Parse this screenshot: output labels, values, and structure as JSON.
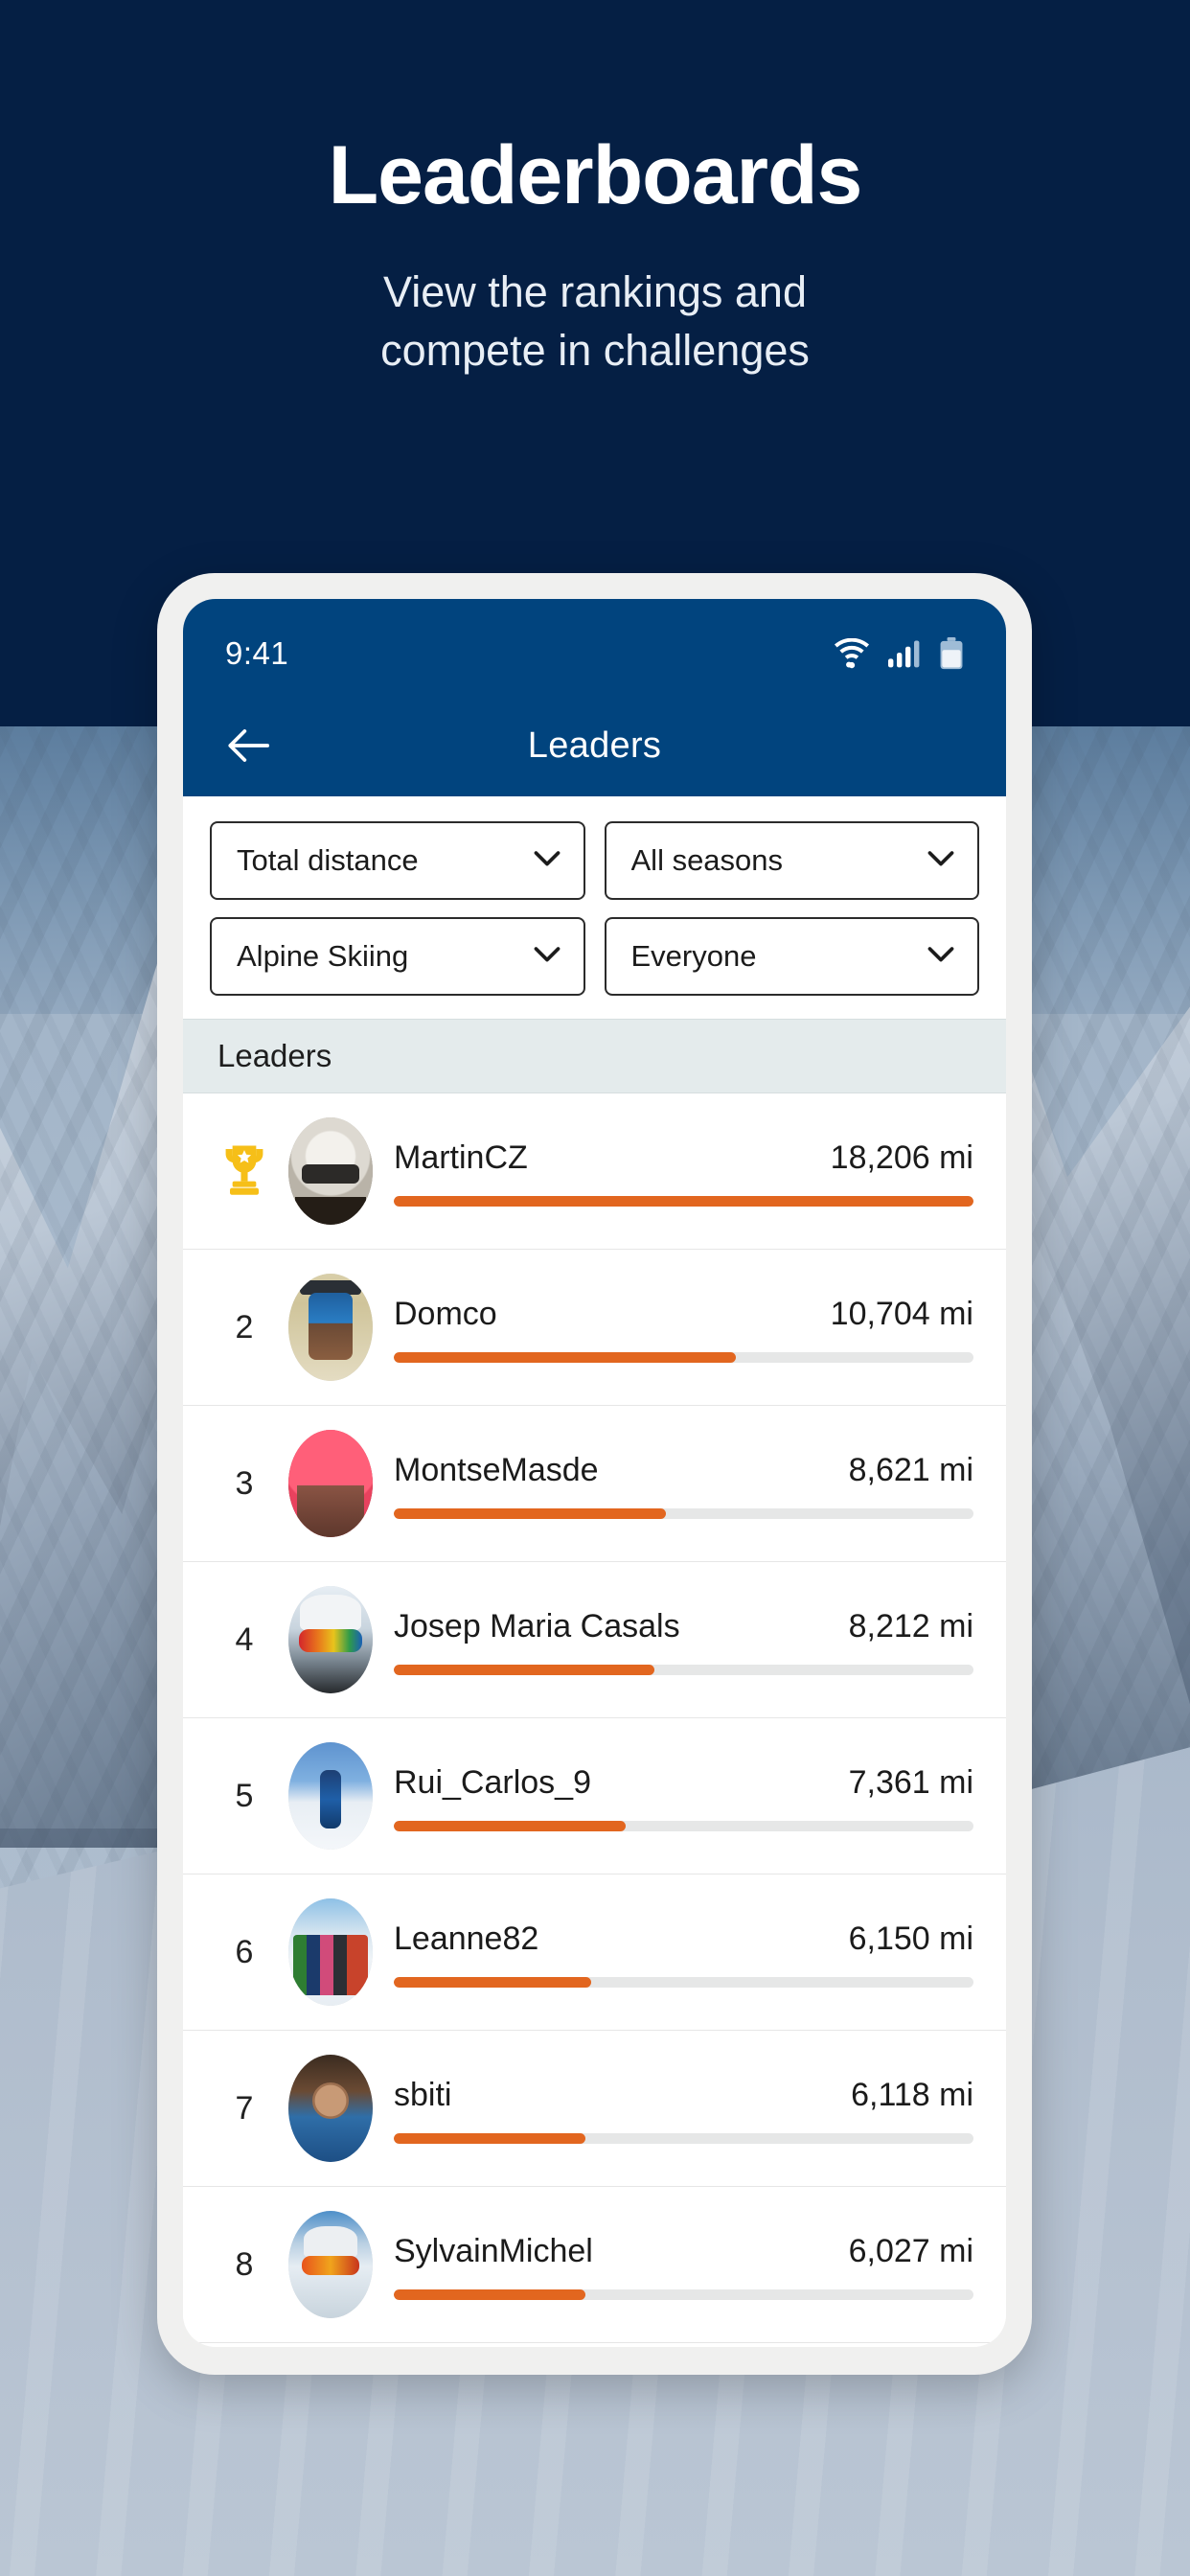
{
  "hero": {
    "title": "Leaderboards",
    "subtitle_line1": "View the rankings and",
    "subtitle_line2": "compete in challenges",
    "bg_color": "#051f44"
  },
  "status_bar": {
    "time": "9:41",
    "icons": [
      "wifi-icon",
      "cellular-signal-icon",
      "battery-icon"
    ]
  },
  "app_bar": {
    "back_icon": "arrow-left-icon",
    "title": "Leaders",
    "bg_color": "#01447e"
  },
  "filters": [
    {
      "name": "metric",
      "value": "Total distance",
      "chevron": "chevron-down-icon"
    },
    {
      "name": "season",
      "value": "All seasons",
      "chevron": "chevron-down-icon"
    },
    {
      "name": "sport",
      "value": "Alpine Skiing",
      "chevron": "chevron-down-icon"
    },
    {
      "name": "audience",
      "value": "Everyone",
      "chevron": "chevron-down-icon"
    }
  ],
  "section": {
    "title": "Leaders"
  },
  "accent_color": "#e2661f",
  "track_color": "#e6e7e7",
  "leaders": [
    {
      "rank": "1",
      "badge": "trophy-icon",
      "name": "MartinCZ",
      "distance": "18,206 mi",
      "value": 18206,
      "percent": 100,
      "avatar": "av-helmet"
    },
    {
      "rank": "2",
      "badge": "",
      "name": "Domco",
      "distance": "10,704 mi",
      "value": 10704,
      "percent": 59,
      "avatar": "av-lift"
    },
    {
      "rank": "3",
      "badge": "",
      "name": "MontseMasde",
      "distance": "8,621 mi",
      "value": 8621,
      "percent": 47,
      "avatar": "av-pink"
    },
    {
      "rank": "4",
      "badge": "",
      "name": "Josep Maria Casals",
      "distance": "8,212 mi",
      "value": 8212,
      "percent": 45,
      "avatar": "av-goggle"
    },
    {
      "rank": "5",
      "badge": "",
      "name": "Rui_Carlos_9",
      "distance": "7,361 mi",
      "value": 7361,
      "percent": 40,
      "avatar": "av-skier"
    },
    {
      "rank": "6",
      "badge": "",
      "name": "Leanne82",
      "distance": "6,150 mi",
      "value": 6150,
      "percent": 34,
      "avatar": "av-group"
    },
    {
      "rank": "7",
      "badge": "",
      "name": "sbiti",
      "distance": "6,118 mi",
      "value": 6118,
      "percent": 33,
      "avatar": "av-indoor"
    },
    {
      "rank": "8",
      "badge": "",
      "name": "SylvainMichel",
      "distance": "6,027 mi",
      "value": 6027,
      "percent": 33,
      "avatar": "av-resort"
    }
  ]
}
